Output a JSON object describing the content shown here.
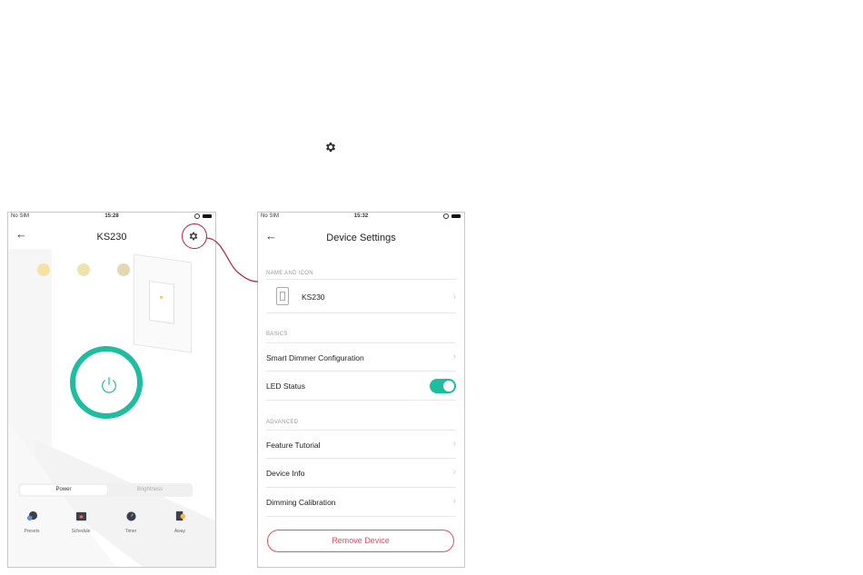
{
  "colors": {
    "accent": "#1dbd9f",
    "danger": "#e9515a",
    "highlight": "#b3263a"
  },
  "top_icon": "gear-icon",
  "device_screen": {
    "status": {
      "carrier": "No SIM",
      "time": "15:28"
    },
    "title": "KS230",
    "segment": {
      "active": "Power",
      "inactive": "Brightness"
    },
    "features": [
      {
        "label": "Presets",
        "icon": "presets-icon"
      },
      {
        "label": "Schedule",
        "icon": "schedule-icon"
      },
      {
        "label": "Timer",
        "icon": "timer-icon"
      },
      {
        "label": "Away",
        "icon": "away-icon"
      }
    ],
    "indicator_colors": [
      "#f5e3a1",
      "#efe3ad",
      "#e3d9b0",
      "#d8d4c2"
    ]
  },
  "settings_screen": {
    "status": {
      "carrier": "No SIM",
      "time": "15:32"
    },
    "title": "Device Settings",
    "sections": {
      "name_icon": "NAME AND ICON",
      "basics": "BASICS",
      "advanced": "ADVANCED"
    },
    "device_name": "KS230",
    "rows": {
      "smart_dimmer": "Smart Dimmer Configuration",
      "led_status": "LED Status",
      "feature_tutorial": "Feature Tutorial",
      "device_info": "Device Info",
      "dimming_calibration": "Dimming Calibration"
    },
    "led_status_on": true,
    "remove_label": "Remove Device"
  }
}
